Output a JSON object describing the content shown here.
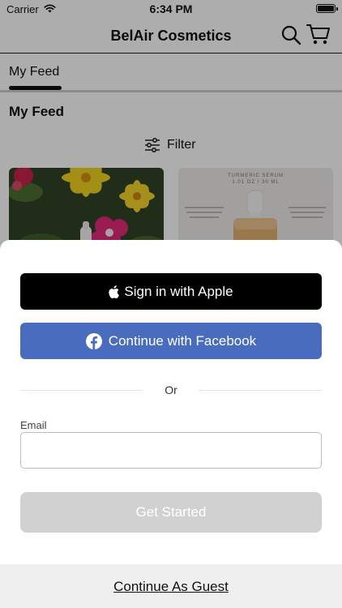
{
  "status_bar": {
    "carrier": "Carrier",
    "time": "6:34 PM"
  },
  "navbar": {
    "title": "BelAir Cosmetics",
    "search_icon": "search-icon",
    "cart_icon": "cart-icon"
  },
  "tabs": [
    {
      "label": "My Feed",
      "selected": true
    }
  ],
  "feed": {
    "section_title": "My Feed",
    "filter_label": "Filter",
    "cards": [
      {
        "image": "flowers-photo"
      },
      {
        "image": "serum-photo",
        "heading": "TURMERIC SERUM",
        "size": "1.01 OZ / 30 ML"
      }
    ]
  },
  "sheet": {
    "apple_button": "Sign in with Apple",
    "facebook_button": "Continue with Facebook",
    "or_label": "Or",
    "email_label": "Email",
    "email_value": "",
    "email_placeholder": "",
    "get_started_button": "Get Started",
    "guest_link": "Continue As Guest"
  },
  "colors": {
    "facebook": "#4a6cbf",
    "apple": "#000000",
    "disabled_button": "#d1d1d1",
    "guest_bar": "#efefef"
  }
}
